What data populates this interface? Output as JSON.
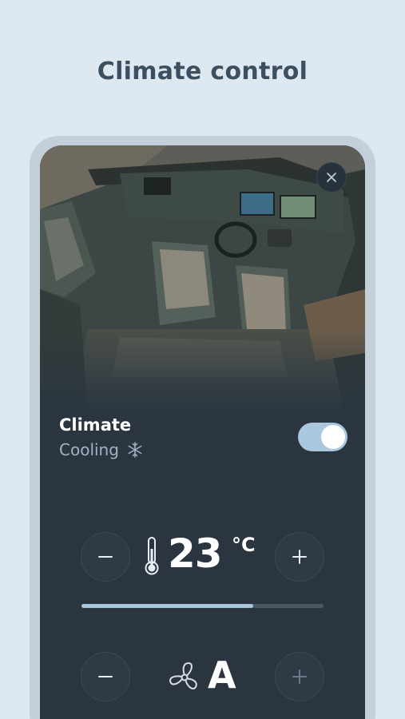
{
  "page": {
    "title": "Climate control"
  },
  "hero": {
    "image_name": "boat-cockpit-illustration"
  },
  "climate": {
    "title": "Climate",
    "status": "Cooling",
    "status_icon": "snowflake-icon",
    "enabled": true
  },
  "temperature": {
    "value": "23",
    "unit": "°C",
    "slider_level": 0.71
  },
  "fan": {
    "mode": "A"
  },
  "colors": {
    "background": "#dde8f1",
    "panel": "#2a3540",
    "accent": "#a9c7dd",
    "title_text": "#3c4f60",
    "secondary_text": "#9fb3c4"
  }
}
